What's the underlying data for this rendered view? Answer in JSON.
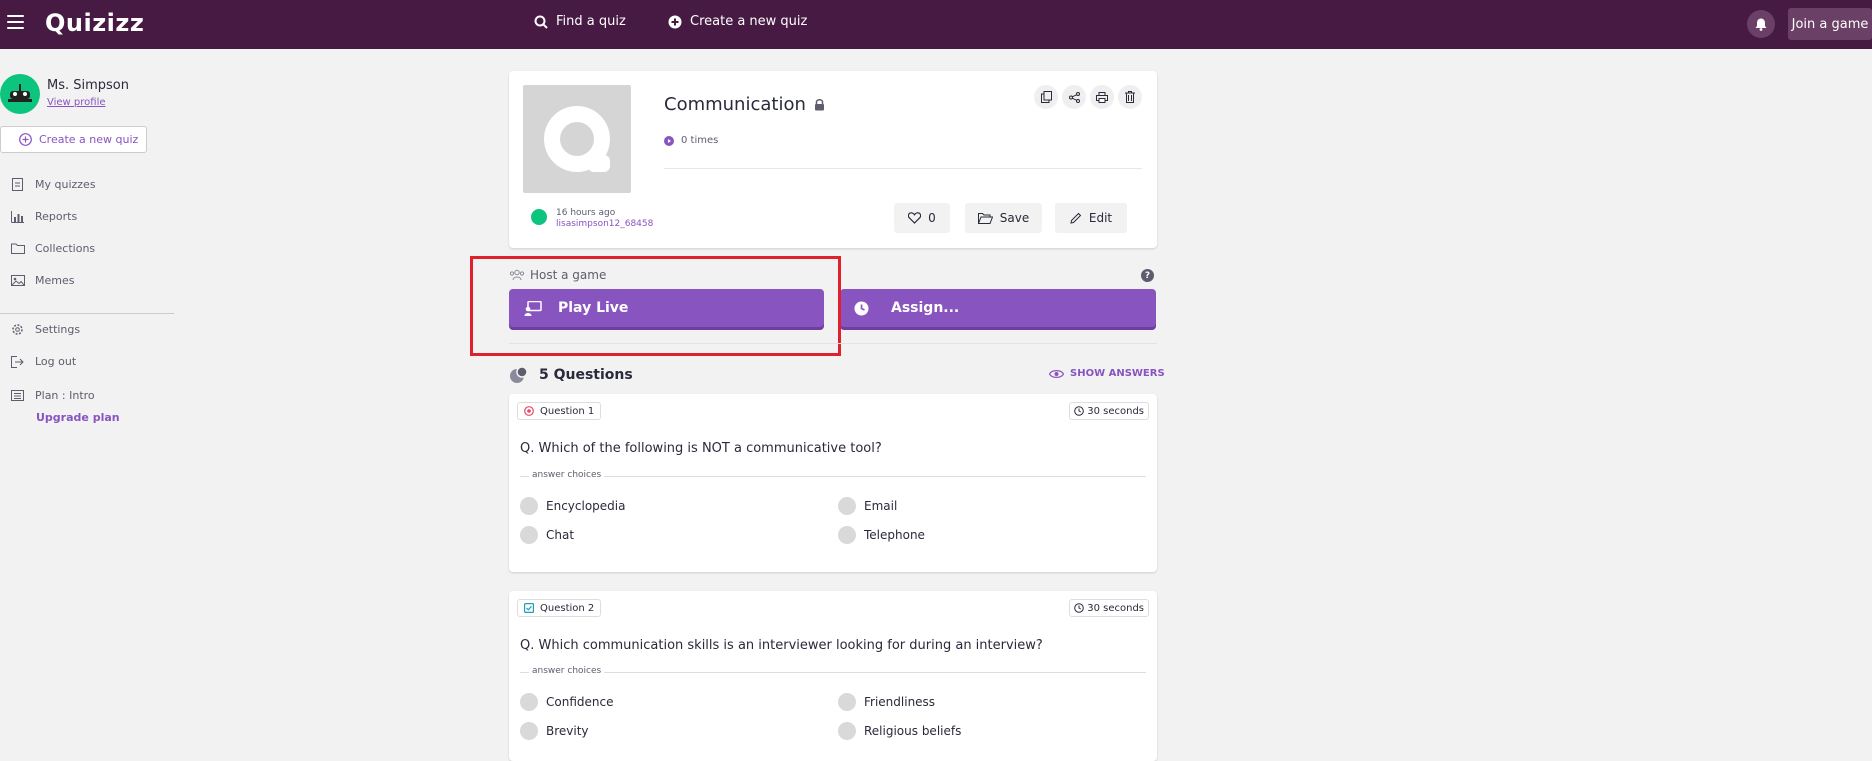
{
  "app": {
    "logo": "Quizizz"
  },
  "topbar": {
    "find_quiz": "Find a quiz",
    "create_quiz": "Create a new quiz",
    "join_game": "Join a game"
  },
  "sidebar": {
    "user_name": "Ms. Simpson",
    "view_profile": "View profile",
    "create_button": "Create a new quiz",
    "items": [
      {
        "label": "My quizzes",
        "icon": "document-icon"
      },
      {
        "label": "Reports",
        "icon": "bar-chart-icon"
      },
      {
        "label": "Collections",
        "icon": "folder-icon"
      },
      {
        "label": "Memes",
        "icon": "image-icon"
      }
    ],
    "settings": "Settings",
    "logout": "Log out",
    "plan": "Plan : Intro",
    "upgrade": "Upgrade plan"
  },
  "quiz": {
    "title": "Communication",
    "plays": "0 times",
    "time_ago": "16 hours ago",
    "author": "lisasimpson12_68458",
    "likes": "0",
    "save_label": "Save",
    "edit_label": "Edit"
  },
  "host": {
    "label": "Host a game",
    "play_live": "Play Live",
    "assign": "Assign..."
  },
  "questions": {
    "count_label": "5 Questions",
    "show_answers": "SHOW ANSWERS",
    "answer_choices_label": "answer choices",
    "items": [
      {
        "tag": "Question 1",
        "time": "30 seconds",
        "text": "Q. Which of the following is NOT a communicative tool?",
        "choices": [
          "Encyclopedia",
          "Email",
          "Chat",
          "Telephone"
        ]
      },
      {
        "tag": "Question 2",
        "time": "30 seconds",
        "text": "Q. Which communication skills is an interviewer looking for during an interview?",
        "choices": [
          "Confidence",
          "Friendliness",
          "Brevity",
          "Religious beliefs"
        ]
      }
    ]
  },
  "colors": {
    "topbar": "#461a42",
    "accent": "#8854c0",
    "highlight": "#e0202a"
  }
}
